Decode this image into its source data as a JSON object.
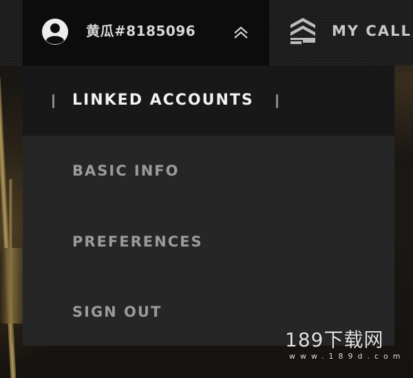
{
  "header": {
    "username": "黄瓜#8185096",
    "nav_label": "MY CALL",
    "icons": {
      "avatar": "user-avatar-icon",
      "toggle": "chevron-up-icon",
      "nav": "chevron-emblem-icon"
    }
  },
  "dropdown": {
    "active_item": "LINKED ACCOUNTS",
    "items": [
      {
        "label": "BASIC INFO"
      },
      {
        "label": "PREFERENCES"
      },
      {
        "label": "SIGN OUT"
      }
    ]
  },
  "watermark": {
    "main": "189下载网",
    "sub": "www.189d.com"
  },
  "colors": {
    "top_bar": "#1c1c1d",
    "profile_tab": "#0c0c0c",
    "dropdown": "#262627",
    "dropdown_active": "#181818",
    "active_text": "#f2f2f2",
    "menu_text": "#9b9b9b"
  }
}
